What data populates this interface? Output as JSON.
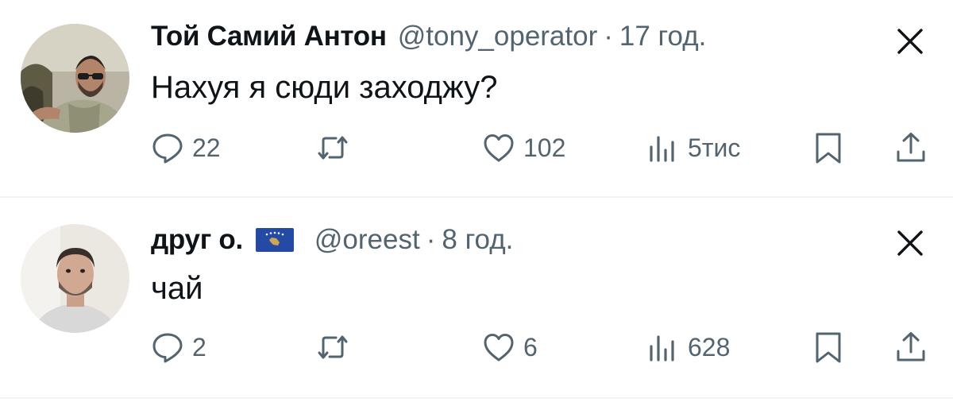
{
  "tweets": [
    {
      "name": "Той Самий Антон",
      "handle": "@tony_operator",
      "separator": "·",
      "time": "17 год.",
      "text": "Нахуя я сюди заходжу?",
      "replies": "22",
      "retweets": "",
      "likes": "102",
      "views": "5тис"
    },
    {
      "name": "друг о.",
      "flag": "kosovo-flag",
      "handle": "@oreest",
      "separator": "·",
      "time": "8 год.",
      "text": "чай",
      "replies": "2",
      "retweets": "",
      "likes": "6",
      "views": "628"
    }
  ],
  "icons": {
    "reply": "reply-icon",
    "retweet": "retweet-icon",
    "like": "like-icon",
    "views": "views-icon",
    "bookmark": "bookmark-icon",
    "share": "share-icon",
    "close": "close-icon"
  },
  "colors": {
    "text": "#0f1419",
    "secondary": "#536471",
    "divider": "#eff3f4",
    "flag_blue": "#244aa5",
    "flag_gold": "#d0a650"
  }
}
